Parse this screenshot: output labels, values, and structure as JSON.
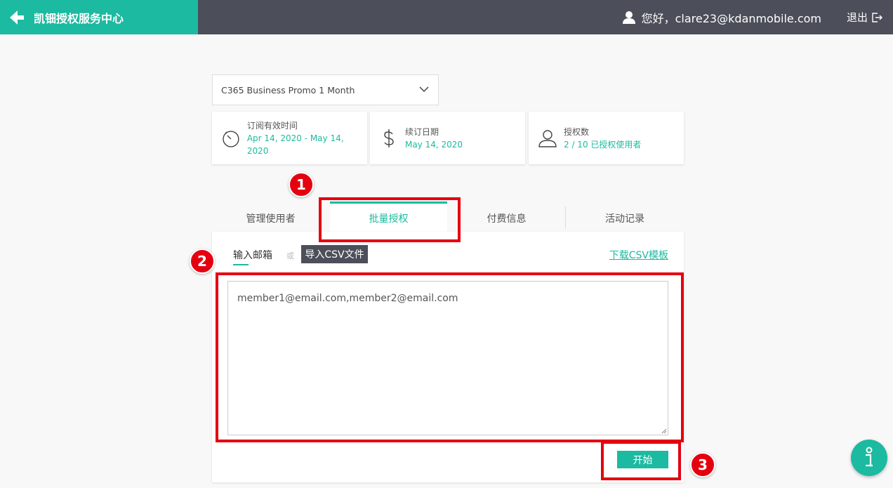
{
  "header": {
    "brand_title": "凯钿授权服务中心",
    "greeting": "您好，clare23@kdanmobile.com",
    "logout_label": "退出"
  },
  "colors": {
    "accent": "#1cbaa0",
    "header_bg": "#4c4f59",
    "highlight": "#e50010"
  },
  "plan_select": {
    "value": "C365 Business Promo 1 Month"
  },
  "cards": [
    {
      "icon": "clock-icon",
      "label": "订阅有效时间",
      "value": "Apr 14, 2020 - May 14, 2020"
    },
    {
      "icon": "dollar-icon",
      "label": "续订日期",
      "value": "May 14, 2020"
    },
    {
      "icon": "user-icon",
      "label": "授权数",
      "value": "2 / 10 已授权使用者"
    }
  ],
  "tabs": [
    {
      "label": "管理使用者",
      "active": false
    },
    {
      "label": "批量授权",
      "active": true
    },
    {
      "label": "付费信息",
      "active": false
    },
    {
      "label": "活动记录",
      "active": false
    }
  ],
  "bulk": {
    "email_tab_label": "输入邮箱",
    "or_label": "或",
    "csv_import_label": "导入CSV文件",
    "download_template_label": "下载CSV模板",
    "textarea_value": "member1@email.com,member2@email.com",
    "start_button_label": "开始"
  },
  "annotations": [
    "1",
    "2",
    "3"
  ]
}
